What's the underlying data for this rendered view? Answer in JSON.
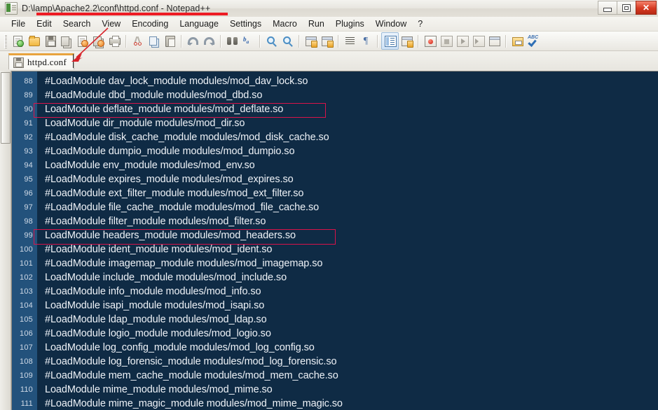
{
  "window": {
    "title": "D:\\lamp\\Apache2.2\\conf\\httpd.conf - Notepad++",
    "icon": "notepadpp-icon",
    "ghost_text": "",
    "controls": {
      "minimize": "minimize-button",
      "maximize": "maximize-button",
      "close": "close-button",
      "close_glyph": "✕"
    }
  },
  "menu": {
    "items": [
      {
        "label": "File"
      },
      {
        "label": "Edit"
      },
      {
        "label": "Search"
      },
      {
        "label": "View"
      },
      {
        "label": "Encoding"
      },
      {
        "label": "Language"
      },
      {
        "label": "Settings"
      },
      {
        "label": "Macro"
      },
      {
        "label": "Run"
      },
      {
        "label": "Plugins"
      },
      {
        "label": "Window"
      },
      {
        "label": "?"
      }
    ]
  },
  "toolbar": {
    "buttons": [
      {
        "name": "new-file-icon"
      },
      {
        "name": "open-file-icon"
      },
      {
        "name": "save-icon"
      },
      {
        "name": "save-all-icon"
      },
      {
        "name": "close-file-icon"
      },
      {
        "name": "close-all-files-icon"
      },
      {
        "name": "print-icon"
      },
      {
        "name": "cut-icon"
      },
      {
        "name": "copy-icon"
      },
      {
        "name": "paste-icon"
      },
      {
        "name": "undo-icon"
      },
      {
        "name": "redo-icon"
      },
      {
        "name": "find-icon"
      },
      {
        "name": "replace-icon"
      },
      {
        "name": "zoom-in-icon"
      },
      {
        "name": "zoom-out-icon"
      },
      {
        "name": "sync-vertical-scroll-icon"
      },
      {
        "name": "sync-horizontal-scroll-icon"
      },
      {
        "name": "word-wrap-icon"
      },
      {
        "name": "show-all-characters-icon"
      },
      {
        "name": "indent-guide-icon"
      },
      {
        "name": "ui-goto-icon"
      },
      {
        "name": "record-macro-icon"
      },
      {
        "name": "stop-recording-icon"
      },
      {
        "name": "play-macro-icon"
      },
      {
        "name": "run-macro-multiple-icon"
      },
      {
        "name": "save-macro-icon"
      },
      {
        "name": "run-icon"
      },
      {
        "name": "spell-check-icon"
      }
    ]
  },
  "tabs": {
    "active_index": 0,
    "items": [
      {
        "label": "httpd.conf",
        "icon": "saved-document-icon"
      }
    ]
  },
  "editor": {
    "first_line": 88,
    "lines": [
      {
        "n": "88",
        "text": "#LoadModule dav_lock_module modules/mod_dav_lock.so"
      },
      {
        "n": "89",
        "text": "#LoadModule dbd_module modules/mod_dbd.so"
      },
      {
        "n": "90",
        "text": "LoadModule deflate_module modules/mod_deflate.so"
      },
      {
        "n": "91",
        "text": "LoadModule dir_module modules/mod_dir.so"
      },
      {
        "n": "92",
        "text": "#LoadModule disk_cache_module modules/mod_disk_cache.so"
      },
      {
        "n": "93",
        "text": "#LoadModule dumpio_module modules/mod_dumpio.so"
      },
      {
        "n": "94",
        "text": "LoadModule env_module modules/mod_env.so"
      },
      {
        "n": "95",
        "text": "#LoadModule expires_module modules/mod_expires.so"
      },
      {
        "n": "96",
        "text": "#LoadModule ext_filter_module modules/mod_ext_filter.so"
      },
      {
        "n": "97",
        "text": "#LoadModule file_cache_module modules/mod_file_cache.so"
      },
      {
        "n": "98",
        "text": "#LoadModule filter_module modules/mod_filter.so"
      },
      {
        "n": "99",
        "text": "LoadModule headers_module modules/mod_headers.so"
      },
      {
        "n": "100",
        "text": "#LoadModule ident_module modules/mod_ident.so"
      },
      {
        "n": "101",
        "text": "#LoadModule imagemap_module modules/mod_imagemap.so"
      },
      {
        "n": "102",
        "text": "LoadModule include_module modules/mod_include.so"
      },
      {
        "n": "103",
        "text": "#LoadModule info_module modules/mod_info.so"
      },
      {
        "n": "104",
        "text": "LoadModule isapi_module modules/mod_isapi.so"
      },
      {
        "n": "105",
        "text": "#LoadModule ldap_module modules/mod_ldap.so"
      },
      {
        "n": "106",
        "text": "#LoadModule logio_module modules/mod_logio.so"
      },
      {
        "n": "107",
        "text": "LoadModule log_config_module modules/mod_log_config.so"
      },
      {
        "n": "108",
        "text": "#LoadModule log_forensic_module modules/mod_log_forensic.so"
      },
      {
        "n": "109",
        "text": "#LoadModule mem_cache_module modules/mod_mem_cache.so"
      },
      {
        "n": "110",
        "text": "LoadModule mime_module modules/mod_mime.so"
      },
      {
        "n": "111",
        "text": "#LoadModule mime_magic_module modules/mod_mime_magic.so"
      }
    ]
  },
  "annotations": {
    "highlight_color": "#d8134a",
    "underline_color": "#ed1c24",
    "boxes": [
      {
        "name": "highlight-line-90",
        "target_line": "90"
      },
      {
        "name": "highlight-line-99",
        "target_line": "99"
      }
    ],
    "title_underline": {
      "name": "title-underline"
    },
    "arrow": {
      "name": "pointer-arrow-to-tab"
    }
  },
  "colors": {
    "editor_background": "#0f2b45",
    "gutter_background": "#23527c",
    "code_text": "#eef2f7",
    "line_number_text": "#cfd9e6",
    "tab_accent": "#e8a33d"
  }
}
